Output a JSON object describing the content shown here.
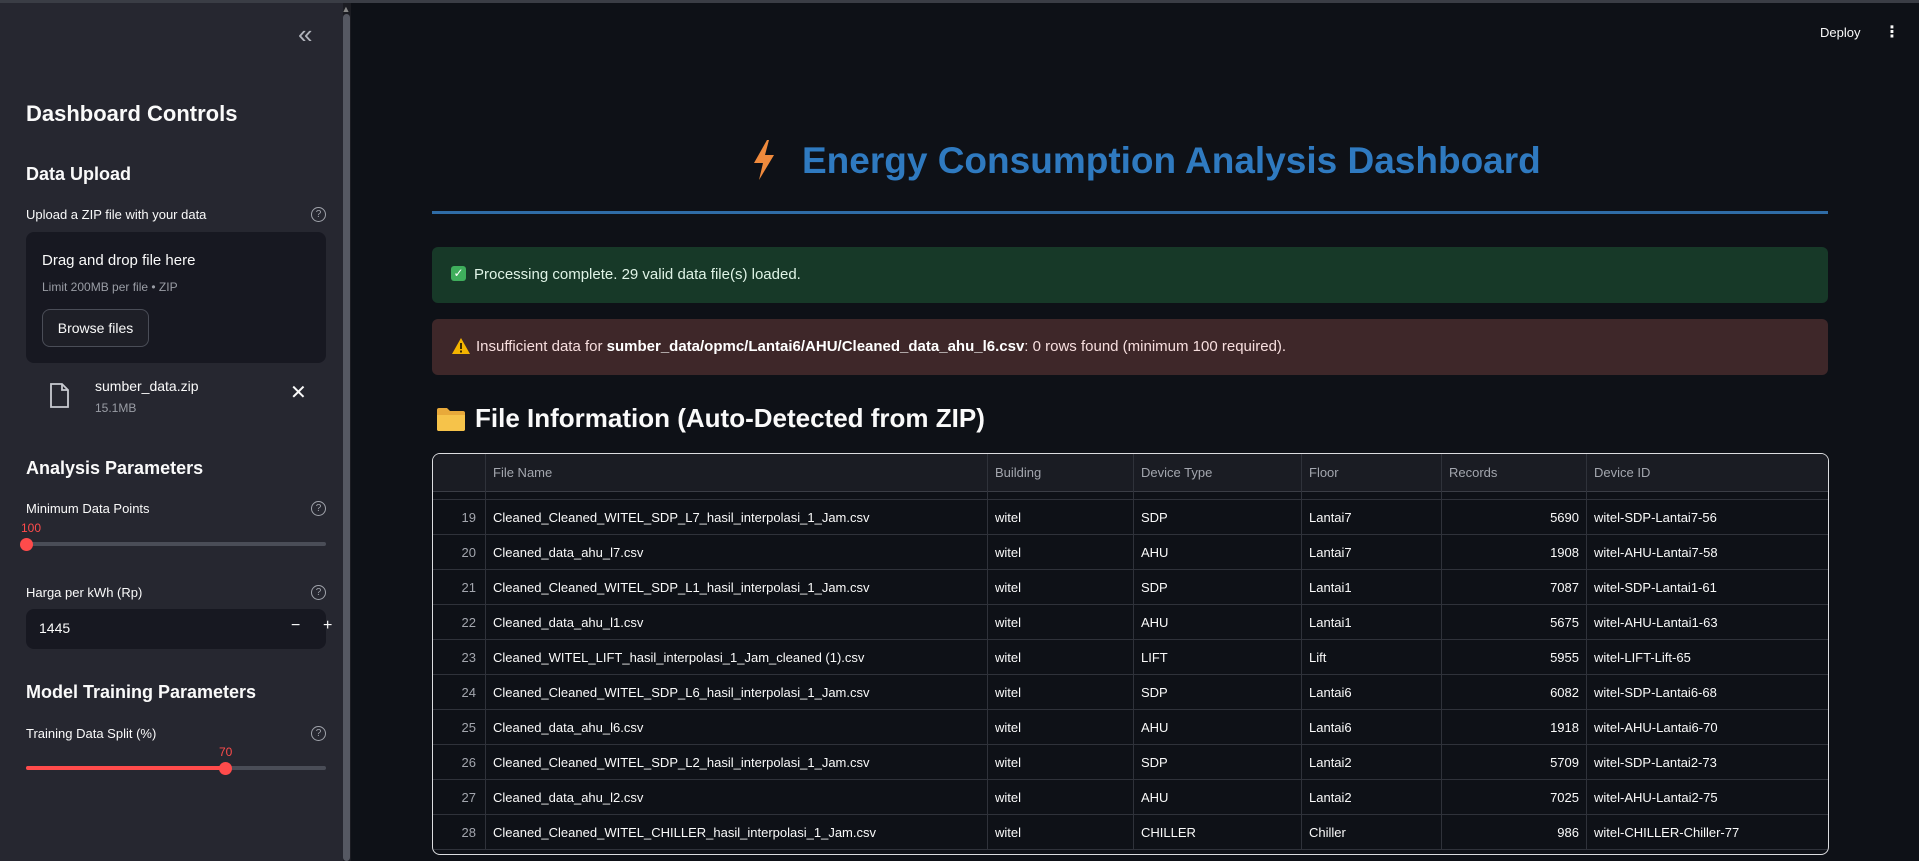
{
  "sidebar": {
    "title": "Dashboard Controls",
    "upload": {
      "heading": "Data Upload",
      "label": "Upload a ZIP file with your data",
      "dropzone_title": "Drag and drop file here",
      "dropzone_limit": "Limit 200MB per file • ZIP",
      "browse_label": "Browse files",
      "file_name": "sumber_data.zip",
      "file_size": "15.1MB"
    },
    "analysis": {
      "heading": "Analysis Parameters",
      "min_points_label": "Minimum Data Points",
      "min_points_value": "100",
      "min_points_fraction": 0.0,
      "price_label": "Harga per kWh (Rp)",
      "price_value": "1445"
    },
    "model": {
      "heading": "Model Training Parameters",
      "split_label": "Training Data Split (%)",
      "split_value": "70",
      "split_fraction": 0.667
    }
  },
  "header": {
    "deploy_label": "Deploy",
    "menu_icon": "kebab-menu-icon"
  },
  "main": {
    "title": "Energy Consumption Analysis Dashboard",
    "title_color": "#2f7ac0",
    "success_message": "Processing complete. 29 valid data file(s) loaded.",
    "error_prefix": "Insufficient data for ",
    "error_path": "sumber_data/opmc/Lantai6/AHU/Cleaned_data_ahu_l6.csv",
    "error_suffix": ": 0 rows found (minimum 100 required).",
    "section_title": "File Information (Auto-Detected from ZIP)"
  },
  "table": {
    "columns": [
      "",
      "File Name",
      "Building",
      "Device Type",
      "Floor",
      "Records",
      "Device ID"
    ],
    "rows": [
      [
        "19",
        "Cleaned_Cleaned_WITEL_SDP_L7_hasil_interpolasi_1_Jam.csv",
        "witel",
        "SDP",
        "Lantai7",
        "5690",
        "witel-SDP-Lantai7-56"
      ],
      [
        "20",
        "Cleaned_data_ahu_l7.csv",
        "witel",
        "AHU",
        "Lantai7",
        "1908",
        "witel-AHU-Lantai7-58"
      ],
      [
        "21",
        "Cleaned_Cleaned_WITEL_SDP_L1_hasil_interpolasi_1_Jam.csv",
        "witel",
        "SDP",
        "Lantai1",
        "7087",
        "witel-SDP-Lantai1-61"
      ],
      [
        "22",
        "Cleaned_data_ahu_l1.csv",
        "witel",
        "AHU",
        "Lantai1",
        "5675",
        "witel-AHU-Lantai1-63"
      ],
      [
        "23",
        "Cleaned_WITEL_LIFT_hasil_interpolasi_1_Jam_cleaned (1).csv",
        "witel",
        "LIFT",
        "Lift",
        "5955",
        "witel-LIFT-Lift-65"
      ],
      [
        "24",
        "Cleaned_Cleaned_WITEL_SDP_L6_hasil_interpolasi_1_Jam.csv",
        "witel",
        "SDP",
        "Lantai6",
        "6082",
        "witel-SDP-Lantai6-68"
      ],
      [
        "25",
        "Cleaned_data_ahu_l6.csv",
        "witel",
        "AHU",
        "Lantai6",
        "1918",
        "witel-AHU-Lantai6-70"
      ],
      [
        "26",
        "Cleaned_Cleaned_WITEL_SDP_L2_hasil_interpolasi_1_Jam.csv",
        "witel",
        "SDP",
        "Lantai2",
        "5709",
        "witel-SDP-Lantai2-73"
      ],
      [
        "27",
        "Cleaned_data_ahu_l2.csv",
        "witel",
        "AHU",
        "Lantai2",
        "7025",
        "witel-AHU-Lantai2-75"
      ],
      [
        "28",
        "Cleaned_Cleaned_WITEL_CHILLER_hasil_interpolasi_1_Jam.csv",
        "witel",
        "CHILLER",
        "Chiller",
        "986",
        "witel-CHILLER-Chiller-77"
      ]
    ]
  }
}
